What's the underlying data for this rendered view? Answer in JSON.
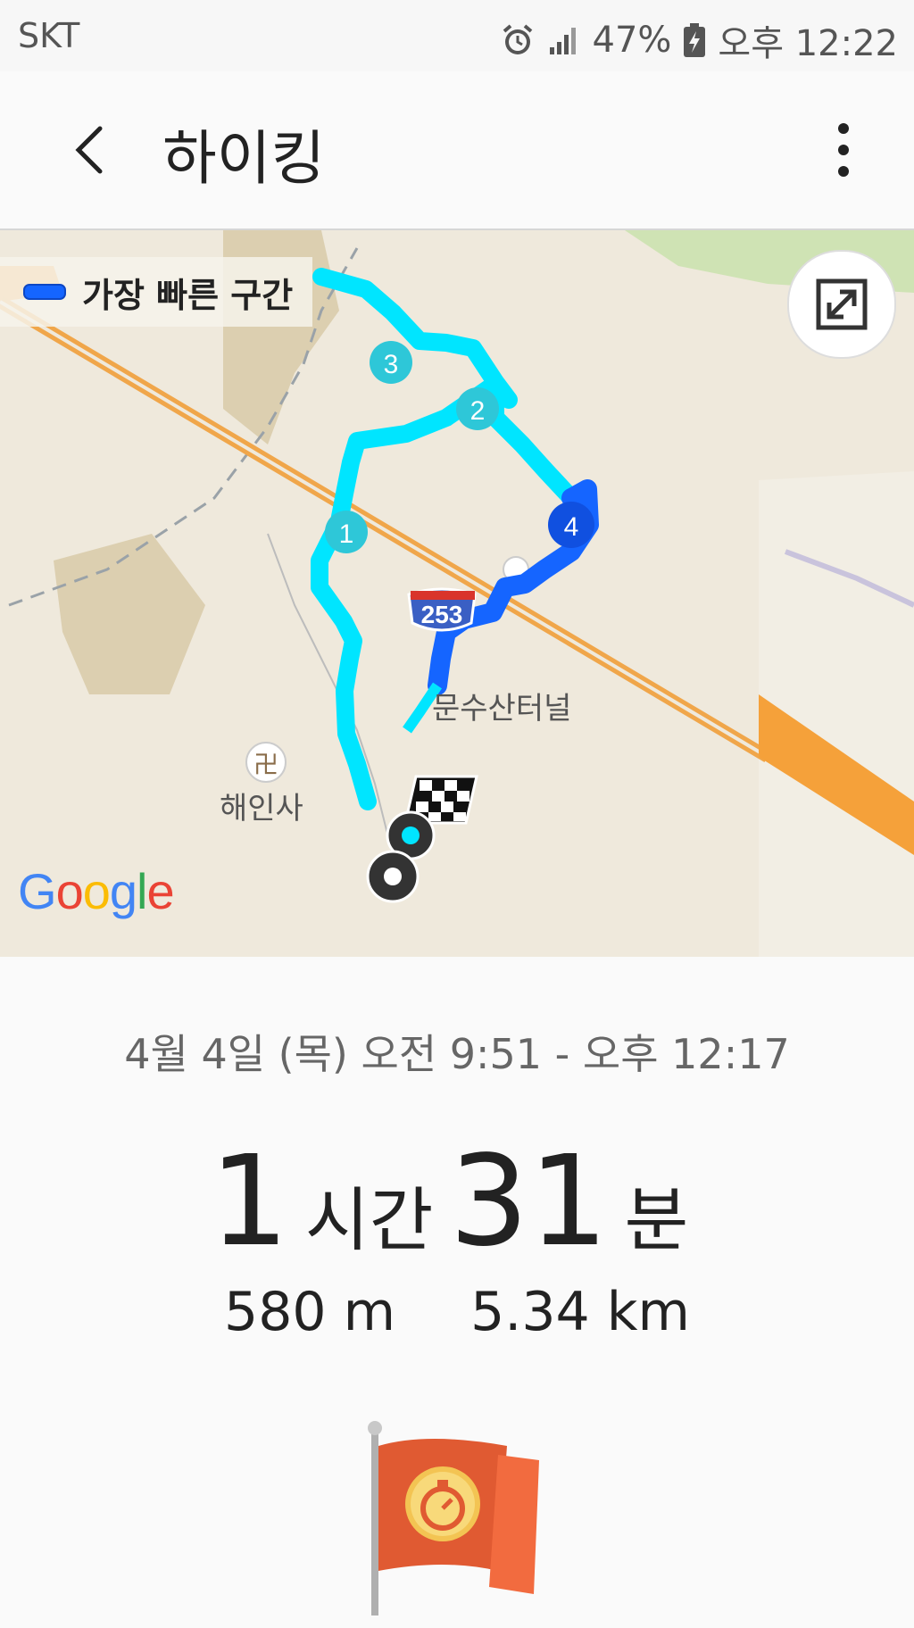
{
  "status_bar": {
    "carrier": "SKT",
    "battery": "47%",
    "time": "오후 12:22"
  },
  "header": {
    "title": "하이킹"
  },
  "map": {
    "legend_label": "가장 빠른 구간",
    "route_markers": [
      "1",
      "2",
      "3",
      "4"
    ],
    "road_shield": "253",
    "tunnel_label": "문수산터널",
    "temple_label": "해인사",
    "temple_symbol": "卍",
    "provider": "Google",
    "colors": {
      "route_light": "#00e5ff",
      "route_fast": "#1565ff",
      "marker_light": "#2ec7d8",
      "marker_fast": "#1050e0"
    }
  },
  "summary": {
    "datetime": "4월 4일 (목) 오전 9:51 - 오후 12:17",
    "hours_value": "1",
    "hours_unit": "시간",
    "minutes_value": "31",
    "minutes_unit": "분",
    "elevation": "580 m",
    "distance": "5.34 km"
  }
}
